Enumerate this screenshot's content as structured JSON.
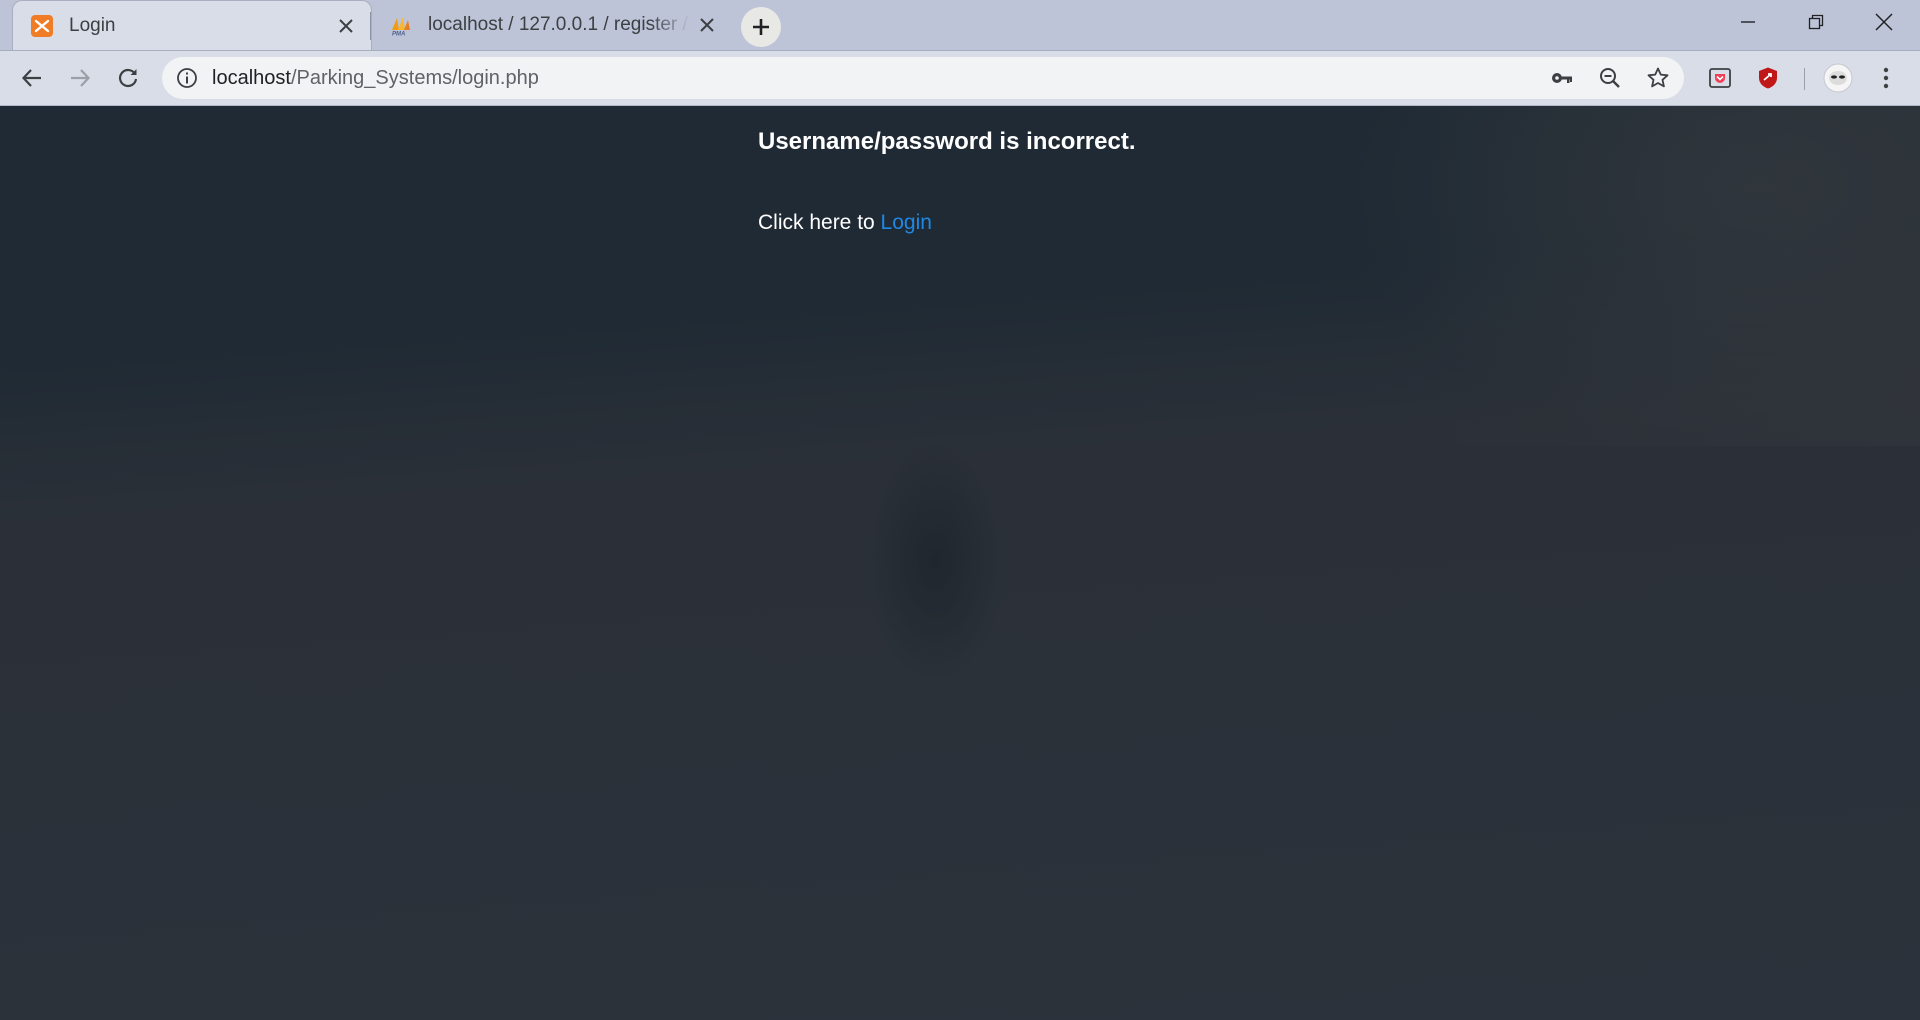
{
  "browser": {
    "tabs": [
      {
        "title": "Login",
        "active": true,
        "favicon": "xampp-icon"
      },
      {
        "title": "localhost / 127.0.0.1 / register / u",
        "active": false,
        "favicon": "phpmyadmin-icon"
      }
    ],
    "address": {
      "host": "localhost",
      "path": "/Parking_Systems/login.php"
    },
    "toolbar_icons": [
      "back-icon",
      "forward-icon",
      "reload-icon",
      "info-icon",
      "key-icon",
      "zoom-out-icon",
      "star-icon"
    ],
    "extensions": [
      "pocket-icon",
      "mcafee-icon",
      "profile-avatar-icon",
      "menu-icon"
    ],
    "window_controls": [
      "minimize-icon",
      "restore-icon",
      "close-icon"
    ]
  },
  "page": {
    "message": "Username/password is incorrect.",
    "prompt_text": "Click here to ",
    "login_link": "Login",
    "link_color": "#1e88e5"
  }
}
